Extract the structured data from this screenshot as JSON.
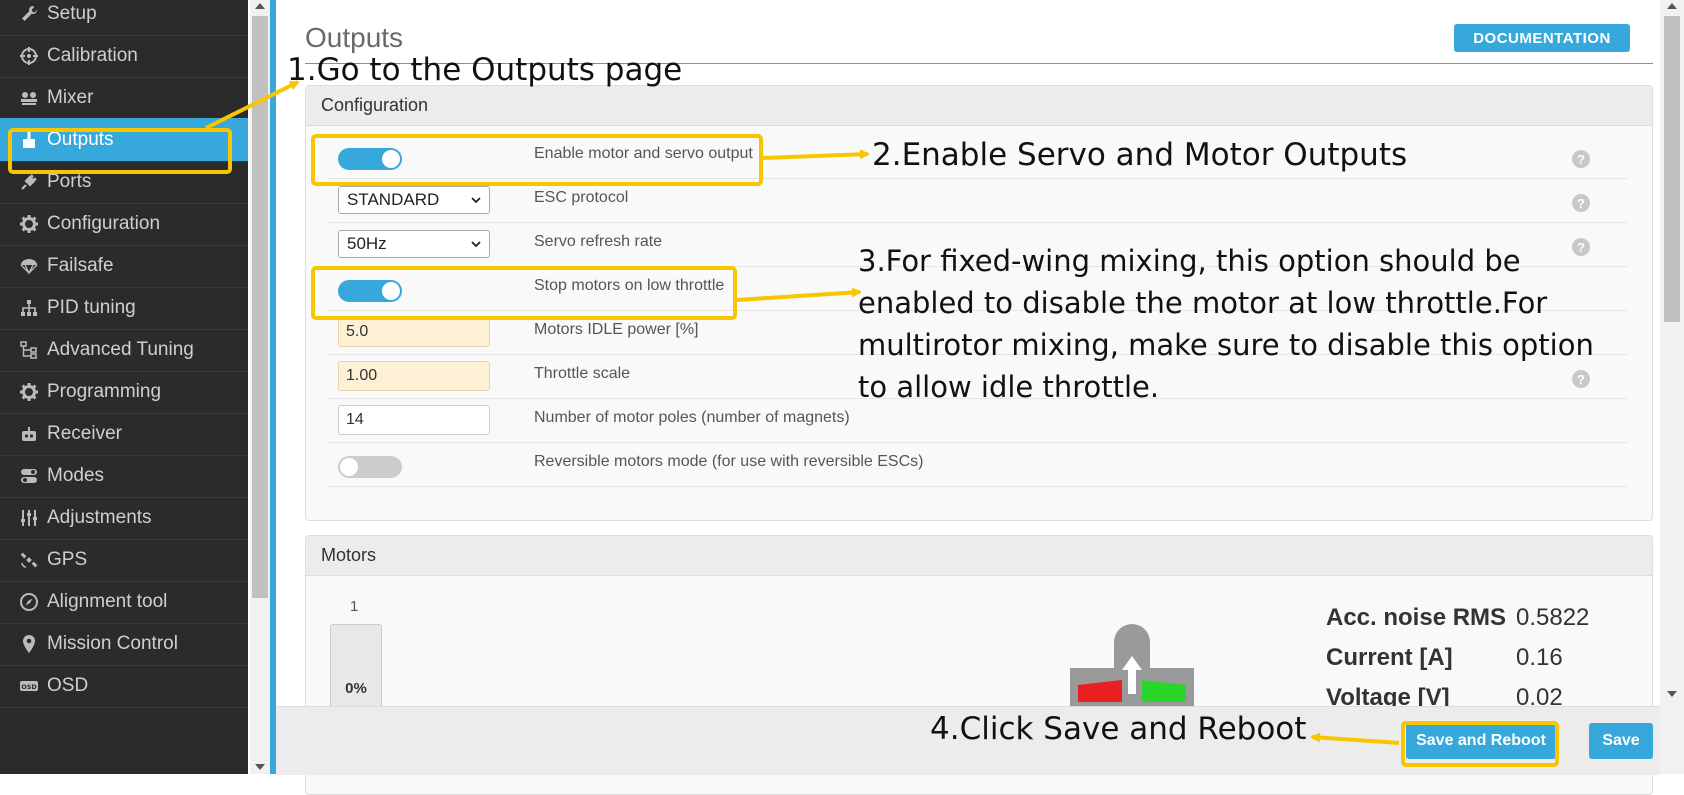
{
  "sidebar": {
    "items": [
      {
        "label": "Setup",
        "icon": "wrench-icon",
        "active": false
      },
      {
        "label": "Calibration",
        "icon": "crosshair-icon",
        "active": false
      },
      {
        "label": "Mixer",
        "icon": "mixer-icon",
        "active": false
      },
      {
        "label": "Outputs",
        "icon": "outputs-icon",
        "active": true
      },
      {
        "label": "Ports",
        "icon": "plug-icon",
        "active": false
      },
      {
        "label": "Configuration",
        "icon": "gear-icon",
        "active": false
      },
      {
        "label": "Failsafe",
        "icon": "parachute-icon",
        "active": false
      },
      {
        "label": "PID tuning",
        "icon": "hierarchy-icon",
        "active": false
      },
      {
        "label": "Advanced Tuning",
        "icon": "tree-icon",
        "active": false
      },
      {
        "label": "Programming",
        "icon": "gear-icon",
        "active": false
      },
      {
        "label": "Receiver",
        "icon": "robot-icon",
        "active": false
      },
      {
        "label": "Modes",
        "icon": "toggles-icon",
        "active": false
      },
      {
        "label": "Adjustments",
        "icon": "sliders-icon",
        "active": false
      },
      {
        "label": "GPS",
        "icon": "satellite-icon",
        "active": false
      },
      {
        "label": "Alignment tool",
        "icon": "compass-icon",
        "active": false
      },
      {
        "label": "Mission Control",
        "icon": "map-pin-icon",
        "active": false
      },
      {
        "label": "OSD",
        "icon": "osd-icon",
        "active": false
      }
    ]
  },
  "page": {
    "title": "Outputs",
    "documentation_label": "DOCUMENTATION"
  },
  "configuration": {
    "header": "Configuration",
    "enable_output": {
      "label": "Enable motor and servo output",
      "enabled": true
    },
    "esc_protocol": {
      "label": "ESC protocol",
      "value": "STANDARD"
    },
    "servo_refresh": {
      "label": "Servo refresh rate",
      "value": "50Hz"
    },
    "stop_motors": {
      "label": "Stop motors on low throttle",
      "enabled": true
    },
    "idle_power": {
      "label": "Motors IDLE power [%]",
      "value": "5.0"
    },
    "throttle_scale": {
      "label": "Throttle scale",
      "value": "1.00"
    },
    "motor_poles": {
      "label": "Number of motor poles (number of magnets)",
      "value": "14"
    },
    "reversible": {
      "label": "Reversible motors mode (for use with reversible ESCs)",
      "enabled": false
    },
    "help_symbol": "?"
  },
  "motors": {
    "header": "Motors",
    "motor_index": "1",
    "motor_value": "0%",
    "stats": [
      {
        "key": "Acc. noise RMS",
        "value": "0.5822"
      },
      {
        "key": "Current [A]",
        "value": "0.16"
      },
      {
        "key": "Voltage [V]",
        "value": "0.02"
      }
    ]
  },
  "footer": {
    "save_reboot_label": "Save and Reboot",
    "save_label": "Save"
  },
  "annotations": {
    "step1": "1.Go to the Outputs page",
    "step2": "2.Enable Servo and Motor Outputs",
    "step3_lines": [
      "3.For fixed-wing mixing, this option should be",
      "enabled to disable the motor at low throttle.For",
      "multirotor mixing, make sure to disable this option",
      "to allow idle throttle."
    ],
    "step4": "4.Click Save and Reboot",
    "highlight_color": "#f9c400"
  },
  "colors": {
    "accent": "#37a8db",
    "sidebar_bg": "#2b2b2b",
    "warn_input_bg": "#fdf0d4"
  }
}
